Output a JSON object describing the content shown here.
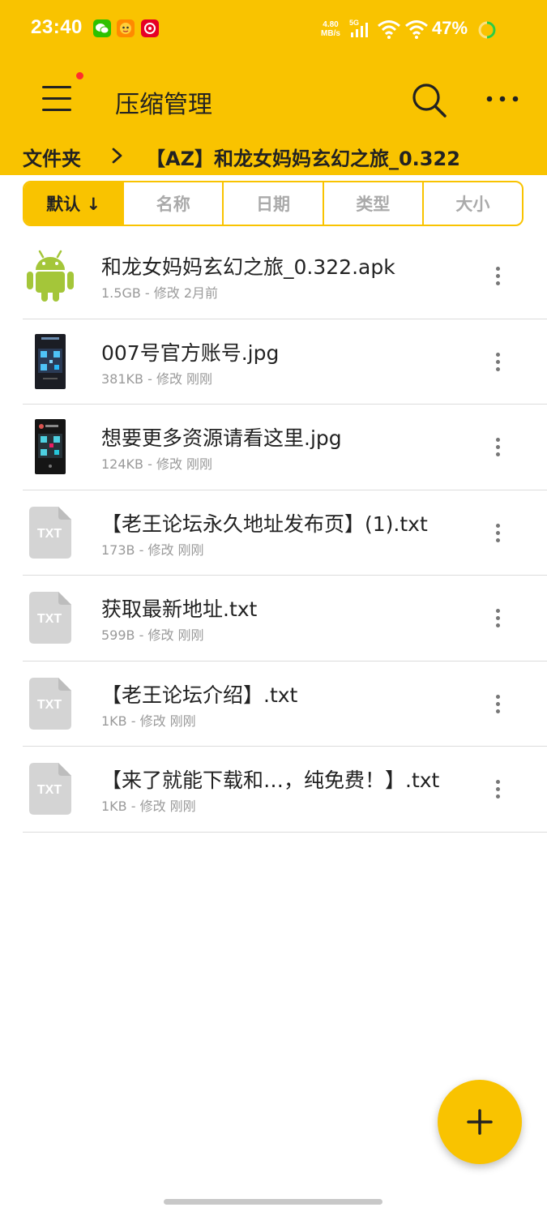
{
  "status_bar": {
    "time": "23:40",
    "net_speed_value": "4.80",
    "net_speed_unit": "MB/s",
    "network_type": "5G",
    "battery": "47%",
    "notification_icons": [
      "wechat-icon",
      "game-app-icon",
      "netease-music-icon"
    ]
  },
  "app_bar": {
    "title": "压缩管理",
    "menu_has_badge": true
  },
  "breadcrumb": {
    "root": "文件夹",
    "current": "【AZ】和龙女妈妈玄幻之旅_0.322"
  },
  "sort_tabs": [
    {
      "label": "默认 ↓",
      "active": true
    },
    {
      "label": "名称",
      "active": false
    },
    {
      "label": "日期",
      "active": false
    },
    {
      "label": "类型",
      "active": false
    },
    {
      "label": "大小",
      "active": false
    }
  ],
  "files": [
    {
      "name": "和龙女妈妈玄幻之旅_0.322.apk",
      "meta": "1.5GB - 修改 2月前",
      "icon": "android-icon"
    },
    {
      "name": "007号官方账号.jpg",
      "meta": "381KB - 修改 刚刚",
      "icon": "image-thumbnail"
    },
    {
      "name": "想要更多资源请看这里.jpg",
      "meta": "124KB - 修改 刚刚",
      "icon": "image-thumbnail"
    },
    {
      "name": "【老王论坛永久地址发布页】(1).txt",
      "meta": "173B - 修改 刚刚",
      "icon": "txt-file-icon"
    },
    {
      "name": "获取最新地址.txt",
      "meta": "599B - 修改 刚刚",
      "icon": "txt-file-icon"
    },
    {
      "name": "【老王论坛介绍】.txt",
      "meta": "1KB - 修改 刚刚",
      "icon": "txt-file-icon"
    },
    {
      "name": "【来了就能下载和…，纯免费！】.txt",
      "meta": "1KB - 修改 刚刚",
      "icon": "txt-file-icon"
    }
  ],
  "txt_icon_label": "TXT",
  "colors": {
    "accent": "#F9C300",
    "android_green": "#A4C639",
    "txt_icon_gray": "#D4D4D4"
  }
}
